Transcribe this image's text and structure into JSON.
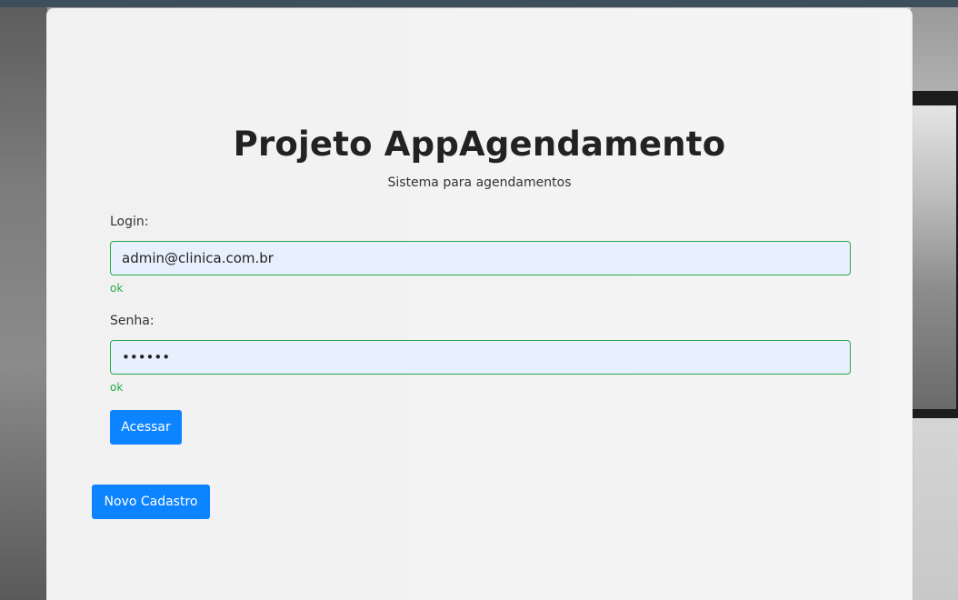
{
  "page": {
    "title": "Projeto AppAgendamento",
    "subtitle": "Sistema para agendamentos"
  },
  "login_form": {
    "login_label": "Login:",
    "login_value": "admin@clinica.com.br",
    "login_feedback": "ok",
    "password_label": "Senha:",
    "password_value": "••••••",
    "password_feedback": "ok",
    "submit_label": "Acessar"
  },
  "actions": {
    "register_label": "Novo Cadastro"
  },
  "colors": {
    "primary": "#0d84ff",
    "valid": "#28a745",
    "autofill_bg": "#e8f0fe"
  }
}
